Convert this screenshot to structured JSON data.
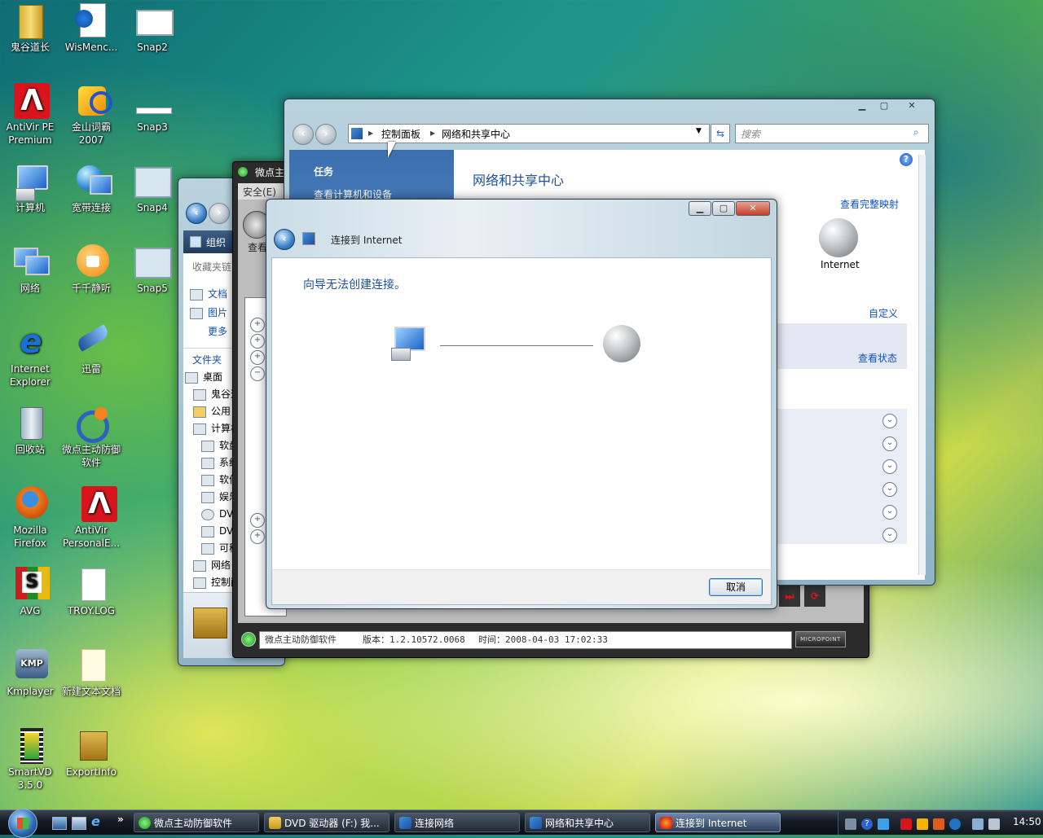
{
  "desktop_icons": [
    {
      "label": "鬼谷道长",
      "icon": "folder-zip-icon"
    },
    {
      "label": "WisMenc...",
      "icon": "settings-doc-icon"
    },
    {
      "label": "Snap2",
      "icon": "window-snapshot-icon"
    },
    {
      "label": "AntiVir PE Premium",
      "icon": "antivir-icon"
    },
    {
      "label": "金山词霸 2007",
      "icon": "dictionary-icon"
    },
    {
      "label": "Snap3",
      "icon": "window-snapshot-icon"
    },
    {
      "label": "计算机",
      "icon": "computer-icon"
    },
    {
      "label": "宽带连接",
      "icon": "broadband-icon"
    },
    {
      "label": "Snap4",
      "icon": "window-snapshot-icon"
    },
    {
      "label": "网络",
      "icon": "network-icon"
    },
    {
      "label": "千千静听",
      "icon": "music-player-icon"
    },
    {
      "label": "Snap5",
      "icon": "window-snapshot-icon"
    },
    {
      "label": "Internet Explorer",
      "icon": "ie-icon"
    },
    {
      "label": "迅雷",
      "icon": "thunder-icon"
    },
    {
      "label": "回收站",
      "icon": "recycle-bin-icon"
    },
    {
      "label": "微点主动防御软件",
      "icon": "micropoint-icon"
    },
    {
      "label": "Mozilla Firefox",
      "icon": "firefox-icon"
    },
    {
      "label": "AntiVir PersonalE...",
      "icon": "antivir-icon"
    },
    {
      "label": "AVG",
      "icon": "avg-icon"
    },
    {
      "label": "TROY.LOG",
      "icon": "text-file-icon"
    },
    {
      "label": "Kmplayer",
      "icon": "kmplayer-icon"
    },
    {
      "label": "新建文本文档",
      "icon": "text-file-icon"
    },
    {
      "label": "SmartVD 3.5.0",
      "icon": "film-icon"
    },
    {
      "label": "ExportInfo",
      "icon": "archive-icon"
    }
  ],
  "explorer_window": {
    "organize": "组织",
    "view": "查看",
    "favorites_header": "收藏夹链",
    "favorites": [
      "文档",
      "图片",
      "更多"
    ],
    "folders_header": "文件夹",
    "tree": [
      "桌面",
      "鬼谷道",
      "公用",
      "计算机",
      "软盘",
      "系统",
      "软件",
      "娱乐",
      "DVD",
      "DVD",
      "可移",
      "网络",
      "控制面"
    ]
  },
  "micropoint_window": {
    "title": "微点主",
    "menu": "安全(E)",
    "status_app": "微点主动防御软件",
    "version": "版本：1.2.10572.0068",
    "time": "时间：2008-04-03 17:02:33",
    "brand": "MICROPOINT"
  },
  "network_center": {
    "breadcrumb": [
      "控制面板",
      "网络和共享中心"
    ],
    "search_placeholder": "搜索",
    "tasks_header": "任务",
    "task_link": "查看计算机和设备",
    "page_title": "网络和共享中心",
    "full_map_link": "查看完整映射",
    "internet_label": "Internet",
    "customize_link": "自定义",
    "view_status_link": "查看状态",
    "help": "?"
  },
  "wizard": {
    "title": "连接到 Internet",
    "message": "向导无法创建连接。",
    "cancel": "取消"
  },
  "taskbar": {
    "buttons": [
      "微点主动防御软件",
      "DVD 驱动器 (F:) 我...",
      "连接网络",
      "网络和共享中心",
      "连接到 Internet"
    ],
    "more": "»",
    "clock": "14:50"
  },
  "colors": {
    "link": "#1452b8",
    "heading": "#1e4fa0",
    "task_pane": "#3b6fae"
  }
}
